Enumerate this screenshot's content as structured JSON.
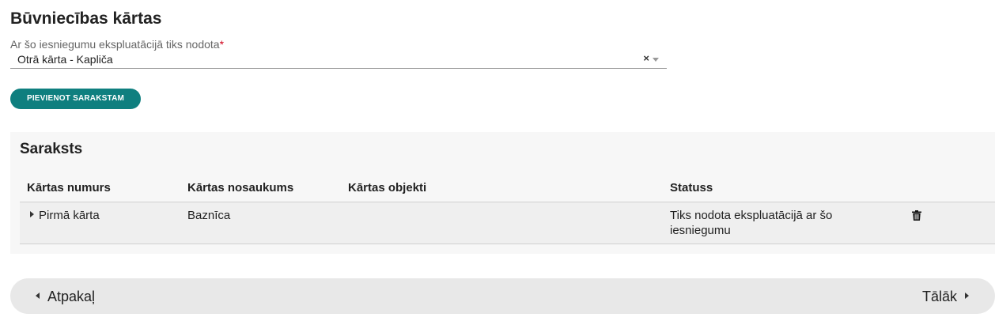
{
  "section": {
    "title": "Būvniecības kārtas"
  },
  "field": {
    "label": "Ar šo iesniegumu ekspluatācijā tiks nodota",
    "required_mark": "*",
    "selected_value": "Otrā kārta - Kapliča",
    "clear_glyph": "×"
  },
  "add_button": {
    "label": "PIEVIENOT SARAKSTAM"
  },
  "list": {
    "title": "Saraksts",
    "columns": [
      "Kārtas numurs",
      "Kārtas nosaukums",
      "Kārtas objekti",
      "Statuss"
    ],
    "rows": [
      {
        "number": "Pirmā kārta",
        "name": "Baznīca",
        "objects": "",
        "status": "Tiks nodota ekspluatācijā ar šo iesniegumu"
      }
    ]
  },
  "nav": {
    "back_label": "Atpakaļ",
    "next_label": "Tālāk"
  },
  "colors": {
    "accent": "#0f7f7f",
    "required": "#d0021b",
    "panel_bg": "#f7f7f7",
    "nav_bg": "#e8e8e8"
  },
  "icons": {
    "clear": "close-icon",
    "dropdown": "chevron-down-icon",
    "expand": "caret-right-icon",
    "delete": "trash-icon",
    "back": "caret-left-icon",
    "next": "caret-right-icon"
  }
}
